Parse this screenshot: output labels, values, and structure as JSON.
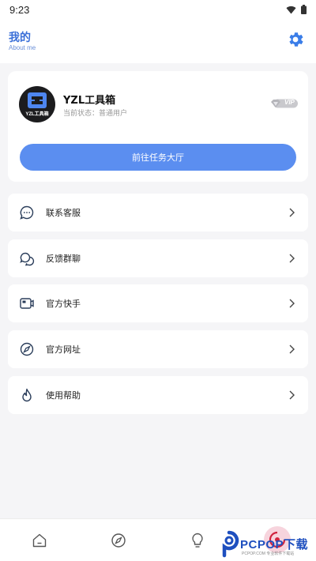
{
  "status_bar": {
    "time": "9:23"
  },
  "header": {
    "title": "我的",
    "subtitle": "About me"
  },
  "profile": {
    "avatar_text": "YZL工具箱",
    "name": "YZL工具箱",
    "status": "当前状态：普通用户",
    "vip_label": "VIP",
    "action_label": "前往任务大厅"
  },
  "menu": {
    "items": [
      {
        "label": "联系客服",
        "icon": "chat-icon"
      },
      {
        "label": "反馈群聊",
        "icon": "group-chat-icon"
      },
      {
        "label": "官方快手",
        "icon": "video-icon"
      },
      {
        "label": "官方网址",
        "icon": "compass-icon"
      },
      {
        "label": "使用帮助",
        "icon": "flame-icon"
      }
    ]
  },
  "bottom_nav": {
    "items": [
      {
        "icon": "home-icon"
      },
      {
        "icon": "compass-icon"
      },
      {
        "icon": "bulb-icon"
      },
      {
        "icon": "profile-icon"
      }
    ]
  },
  "watermark": {
    "text": "PCPOP下载",
    "sub": "PCPOP.COM 专业软件下载站"
  },
  "colors": {
    "accent": "#5b8ef0",
    "title": "#3a6fd8",
    "background": "#f5f5f7"
  }
}
